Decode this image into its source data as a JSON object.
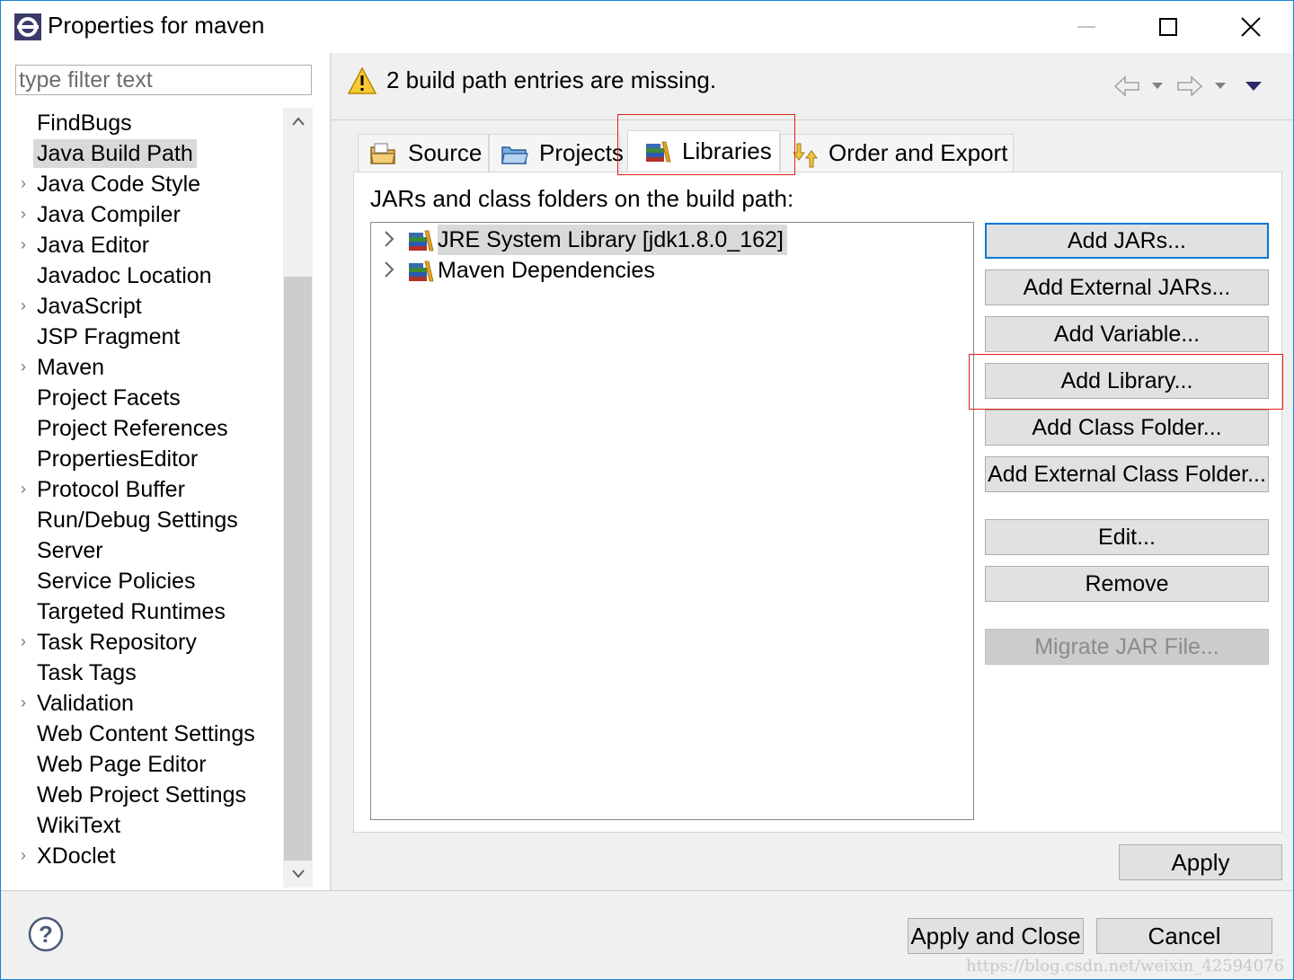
{
  "window": {
    "title": "Properties for maven",
    "controls": [
      "minimize",
      "maximize",
      "close"
    ]
  },
  "filter": {
    "placeholder": "type filter text"
  },
  "sidebar": {
    "items": [
      {
        "label": "FindBugs",
        "expandable": false
      },
      {
        "label": "Java Build Path",
        "expandable": false,
        "selected": true
      },
      {
        "label": "Java Code Style",
        "expandable": true
      },
      {
        "label": "Java Compiler",
        "expandable": true
      },
      {
        "label": "Java Editor",
        "expandable": true
      },
      {
        "label": "Javadoc Location",
        "expandable": false
      },
      {
        "label": "JavaScript",
        "expandable": true
      },
      {
        "label": "JSP Fragment",
        "expandable": false
      },
      {
        "label": "Maven",
        "expandable": true
      },
      {
        "label": "Project Facets",
        "expandable": false
      },
      {
        "label": "Project References",
        "expandable": false
      },
      {
        "label": "PropertiesEditor",
        "expandable": false
      },
      {
        "label": "Protocol Buffer",
        "expandable": true
      },
      {
        "label": "Run/Debug Settings",
        "expandable": false
      },
      {
        "label": "Server",
        "expandable": false
      },
      {
        "label": "Service Policies",
        "expandable": false
      },
      {
        "label": "Targeted Runtimes",
        "expandable": false
      },
      {
        "label": "Task Repository",
        "expandable": true
      },
      {
        "label": "Task Tags",
        "expandable": false
      },
      {
        "label": "Validation",
        "expandable": true
      },
      {
        "label": "Web Content Settings",
        "expandable": false
      },
      {
        "label": "Web Page Editor",
        "expandable": false
      },
      {
        "label": "Web Project Settings",
        "expandable": false
      },
      {
        "label": "WikiText",
        "expandable": false
      },
      {
        "label": "XDoclet",
        "expandable": true
      }
    ]
  },
  "message": {
    "text": "2 build path entries are missing.",
    "icon": "warning-icon"
  },
  "tabs": [
    {
      "label": "Source",
      "icon": "source-folder-icon"
    },
    {
      "label": "Projects",
      "icon": "projects-icon"
    },
    {
      "label": "Libraries",
      "icon": "libraries-icon",
      "active": true
    },
    {
      "label": "Order and Export",
      "icon": "order-export-icon"
    }
  ],
  "libraries": {
    "heading": "JARs and class folders on the build path:",
    "entries": [
      {
        "label": "JRE System Library [jdk1.8.0_162]",
        "selected": true
      },
      {
        "label": "Maven Dependencies",
        "selected": false
      }
    ]
  },
  "buttons": {
    "add_jars": "Add JARs...",
    "add_external_jars": "Add External JARs...",
    "add_variable": "Add Variable...",
    "add_library": "Add Library...",
    "add_class_folder": "Add Class Folder...",
    "add_external_class_folder": "Add External Class Folder...",
    "edit": "Edit...",
    "remove": "Remove",
    "migrate_jar": "Migrate JAR File...",
    "apply": "Apply",
    "apply_and_close": "Apply and Close",
    "cancel": "Cancel"
  },
  "watermark": "https://blog.csdn.net/weixin_42594076",
  "colors": {
    "accent": "#0078d7",
    "highlight_box": "#e02020",
    "selection": "#d9d9d9"
  }
}
